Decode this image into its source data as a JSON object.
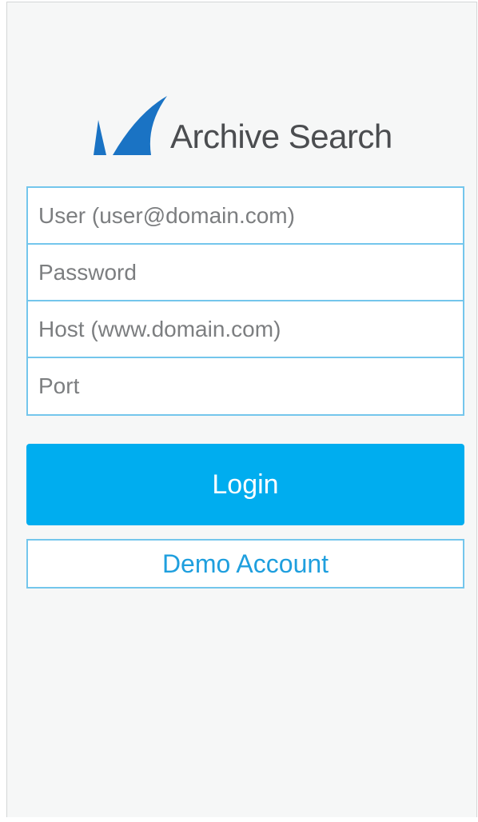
{
  "app": {
    "title": "Archive Search",
    "brand_color": "#00adef",
    "logo_icon": "barracuda-fin-icon"
  },
  "form": {
    "fields": [
      {
        "name": "user",
        "placeholder": "User (user@domain.com)",
        "value": ""
      },
      {
        "name": "password",
        "placeholder": "Password",
        "value": ""
      },
      {
        "name": "host",
        "placeholder": "Host (www.domain.com)",
        "value": ""
      },
      {
        "name": "port",
        "placeholder": "Port",
        "value": ""
      }
    ]
  },
  "actions": {
    "login_label": "Login",
    "demo_label": "Demo Account"
  }
}
